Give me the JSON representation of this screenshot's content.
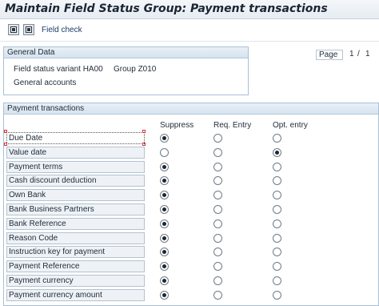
{
  "window": {
    "title": "Maintain Field Status Group: Payment transactions"
  },
  "toolbar": {
    "buttons": [
      {
        "icon": "save-icon"
      },
      {
        "icon": "document-icon"
      }
    ],
    "field_check_label": "Field check"
  },
  "general_data": {
    "header": "General Data",
    "field_status_variant": "Field status variant HA00",
    "group": "Group Z010",
    "description": "General accounts"
  },
  "pager": {
    "label": "Page",
    "current": "1",
    "separator": "/",
    "total": "1"
  },
  "payment_transactions": {
    "header": "Payment transactions",
    "columns": [
      "Suppress",
      "Req. Entry",
      "Opt. entry"
    ],
    "rows": [
      {
        "label": "Due Date",
        "selected": "Suppress"
      },
      {
        "label": "Value date",
        "selected": "Opt. entry"
      },
      {
        "label": "Payment terms",
        "selected": "Suppress"
      },
      {
        "label": "Cash discount deduction",
        "selected": "Suppress"
      },
      {
        "label": "Own Bank",
        "selected": "Suppress"
      },
      {
        "label": "Bank Business Partners",
        "selected": "Suppress"
      },
      {
        "label": "Bank Reference",
        "selected": "Suppress"
      },
      {
        "label": "Reason Code",
        "selected": "Suppress"
      },
      {
        "label": "Instruction key for payment",
        "selected": "Suppress"
      },
      {
        "label": "Payment Reference",
        "selected": "Suppress"
      },
      {
        "label": "Payment currency",
        "selected": "Suppress"
      },
      {
        "label": "Payment currency amount",
        "selected": "Suppress"
      }
    ]
  }
}
